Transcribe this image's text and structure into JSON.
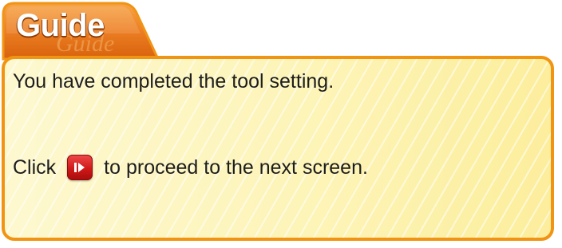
{
  "tab": {
    "title": "Guide",
    "watermark": "Guide"
  },
  "message": {
    "line1": "You have completed the tool setting.",
    "line2_prefix": "Click",
    "line2_suffix": "to proceed to the next screen."
  },
  "icons": {
    "next_button": "next-screen-icon"
  },
  "colors": {
    "tab_orange": "#e8761f",
    "border_orange": "#f19413",
    "box_yellow": "#fdf4b8",
    "button_red": "#d01818"
  }
}
